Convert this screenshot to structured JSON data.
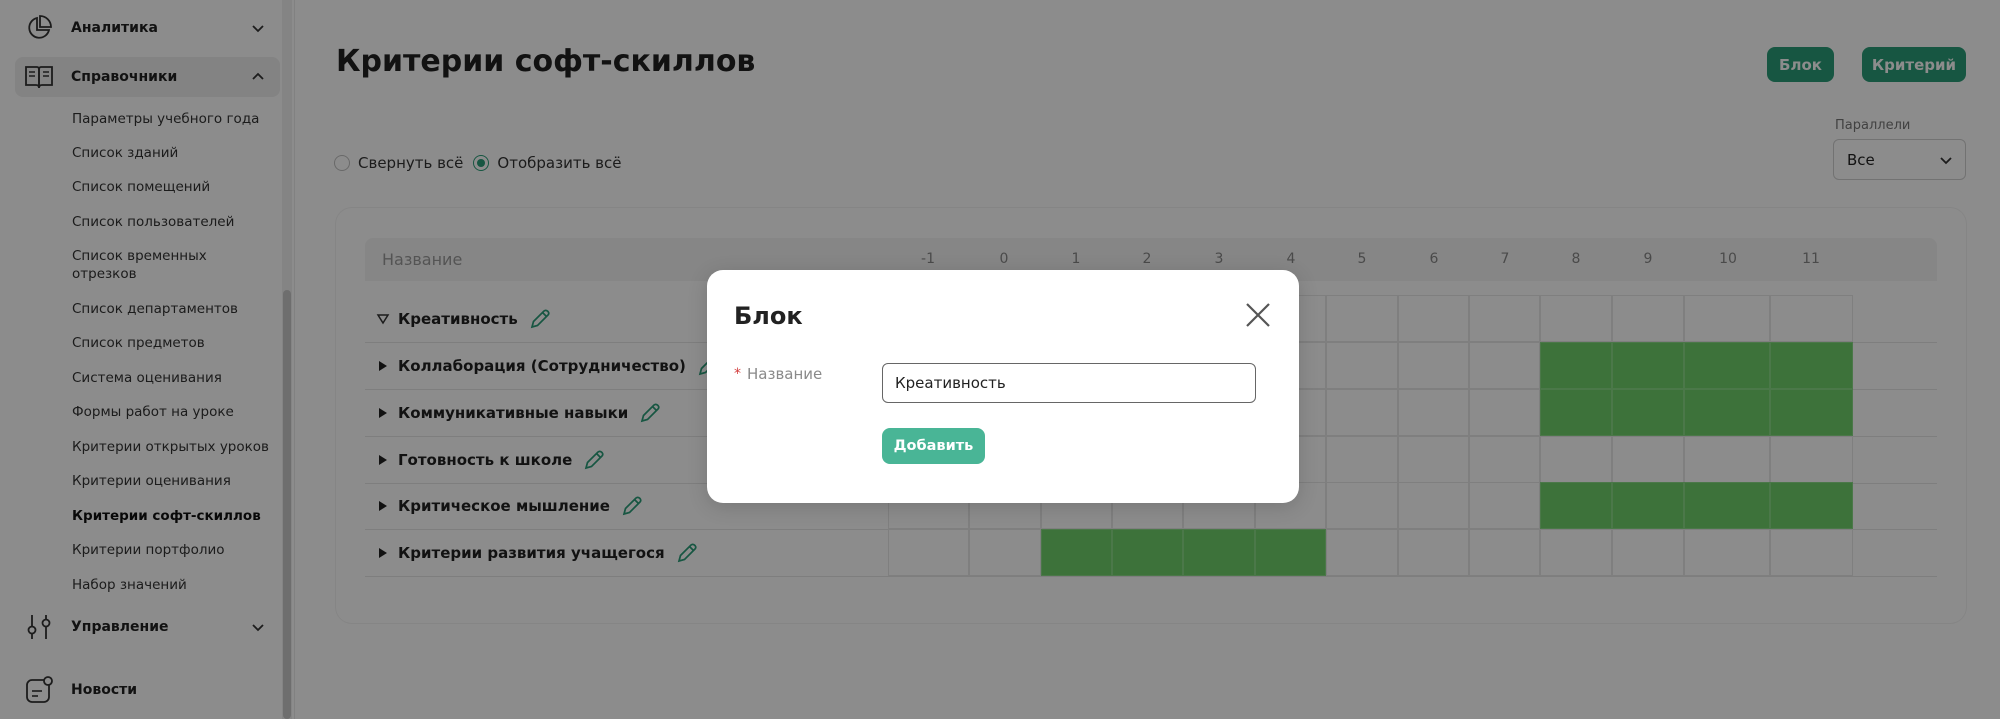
{
  "sidebar": {
    "sections": [
      {
        "label": "Аналитика",
        "icon": "pie-chart-icon",
        "expanded": false
      },
      {
        "label": "Справочники",
        "icon": "book-icon",
        "expanded": true
      },
      {
        "label": "Управление",
        "icon": "sliders-icon",
        "expanded": false
      },
      {
        "label": "Новости",
        "icon": "news-icon"
      }
    ],
    "items": [
      "Параметры учебного года",
      "Список зданий",
      "Список помещений",
      "Список пользователей",
      "Список временных",
      "отрезков",
      "Список департаментов",
      "Список предметов",
      "Система оценивания",
      "Формы работ на уроке",
      "Критерии открытых уроков",
      "Критерии оценивания",
      "Критерии софт-скиллов",
      "Критерии портфолио",
      "Набор значений"
    ],
    "current_item": "Критерии софт-скиллов"
  },
  "header": {
    "title": "Критерии софт-скиллов",
    "btn_block": "Блок",
    "btn_criterion": "Критерий"
  },
  "view_toggle": {
    "collapse_label": "Свернуть всё",
    "expand_label": "Отобразить всё",
    "selected": "expand"
  },
  "filter": {
    "label": "Параллели",
    "value": "Все"
  },
  "table": {
    "name_header": "Название",
    "columns": [
      "-1",
      "0",
      "1",
      "2",
      "3",
      "4",
      "5",
      "6",
      "7",
      "8",
      "9",
      "10",
      "11"
    ],
    "rows": [
      {
        "label": "Креативность",
        "expanded": true,
        "active": []
      },
      {
        "label": "Коллаборация (Сотрудничество)",
        "expanded": false,
        "active": [
          "8",
          "9",
          "10",
          "11"
        ]
      },
      {
        "label": "Коммуникативные навыки",
        "expanded": false,
        "active": [
          "8",
          "9",
          "10",
          "11"
        ]
      },
      {
        "label": "Готовность к школе",
        "expanded": false,
        "active": []
      },
      {
        "label": "Критическое мышление",
        "expanded": false,
        "active": [
          "8",
          "9",
          "10",
          "11"
        ]
      },
      {
        "label": "Критерии развития учащегося",
        "expanded": false,
        "active": [
          "1",
          "2",
          "3",
          "4"
        ]
      }
    ],
    "active_color": "#6fd06b"
  },
  "modal": {
    "title": "Блок",
    "field_label": "Название",
    "required_mark": "*",
    "field_value": "Креативность",
    "add_button": "Добавить"
  },
  "colors": {
    "accent": "#2a9d78",
    "modal_button": "#49b596"
  }
}
